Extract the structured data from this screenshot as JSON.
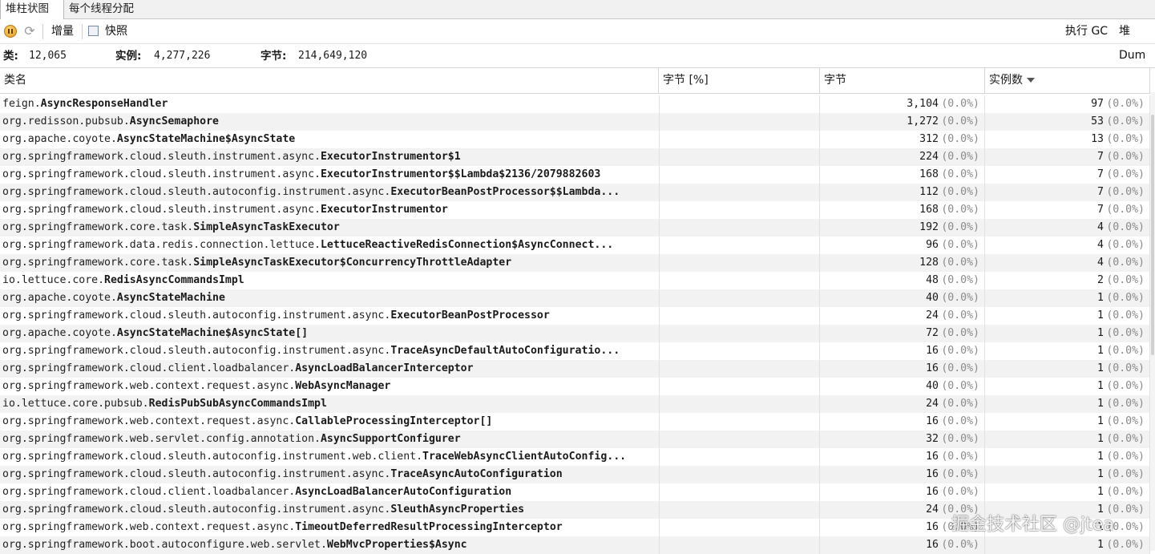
{
  "tabs": [
    {
      "label": "堆柱状图"
    },
    {
      "label": "每个线程分配"
    }
  ],
  "toolbar": {
    "delta_label": "增量",
    "snapshot_label": "快照",
    "gc_label": "执行 GC",
    "dump_label": "堆 Dum"
  },
  "stats": {
    "classes_label": "类:",
    "classes_value": "12,065",
    "instances_label": "实例:",
    "instances_value": "4,277,226",
    "bytes_label": "字节:",
    "bytes_value": "214,649,120"
  },
  "columns": {
    "class_name": "类名",
    "bytes_pct": "字节 [%]",
    "bytes": "字节",
    "instances": "实例数"
  },
  "rows": [
    {
      "pkg": "feign.",
      "cls": "AsyncResponseHandler",
      "bytes": "3,104",
      "bytes_pct": "(0.0%)",
      "inst": "97",
      "inst_pct": "(0.0%)"
    },
    {
      "pkg": "org.redisson.pubsub.",
      "cls": "AsyncSemaphore",
      "bytes": "1,272",
      "bytes_pct": "(0.0%)",
      "inst": "53",
      "inst_pct": "(0.0%)"
    },
    {
      "pkg": "org.apache.coyote.",
      "cls": "AsyncStateMachine$AsyncState",
      "bytes": "312",
      "bytes_pct": "(0.0%)",
      "inst": "13",
      "inst_pct": "(0.0%)"
    },
    {
      "pkg": "org.springframework.cloud.sleuth.instrument.async.",
      "cls": "ExecutorInstrumentor$1",
      "bytes": "224",
      "bytes_pct": "(0.0%)",
      "inst": "7",
      "inst_pct": "(0.0%)"
    },
    {
      "pkg": "org.springframework.cloud.sleuth.instrument.async.",
      "cls": "ExecutorInstrumentor$$Lambda$2136/2079882603",
      "bytes": "168",
      "bytes_pct": "(0.0%)",
      "inst": "7",
      "inst_pct": "(0.0%)"
    },
    {
      "pkg": "org.springframework.cloud.sleuth.autoconfig.instrument.async.",
      "cls": "ExecutorBeanPostProcessor$$Lambda...",
      "bytes": "112",
      "bytes_pct": "(0.0%)",
      "inst": "7",
      "inst_pct": "(0.0%)"
    },
    {
      "pkg": "org.springframework.cloud.sleuth.instrument.async.",
      "cls": "ExecutorInstrumentor",
      "bytes": "168",
      "bytes_pct": "(0.0%)",
      "inst": "7",
      "inst_pct": "(0.0%)"
    },
    {
      "pkg": "org.springframework.core.task.",
      "cls": "SimpleAsyncTaskExecutor",
      "bytes": "192",
      "bytes_pct": "(0.0%)",
      "inst": "4",
      "inst_pct": "(0.0%)"
    },
    {
      "pkg": "org.springframework.data.redis.connection.lettuce.",
      "cls": "LettuceReactiveRedisConnection$AsyncConnect...",
      "bytes": "96",
      "bytes_pct": "(0.0%)",
      "inst": "4",
      "inst_pct": "(0.0%)"
    },
    {
      "pkg": "org.springframework.core.task.",
      "cls": "SimpleAsyncTaskExecutor$ConcurrencyThrottleAdapter",
      "bytes": "128",
      "bytes_pct": "(0.0%)",
      "inst": "4",
      "inst_pct": "(0.0%)"
    },
    {
      "pkg": "io.lettuce.core.",
      "cls": "RedisAsyncCommandsImpl",
      "bytes": "48",
      "bytes_pct": "(0.0%)",
      "inst": "2",
      "inst_pct": "(0.0%)"
    },
    {
      "pkg": "org.apache.coyote.",
      "cls": "AsyncStateMachine",
      "bytes": "40",
      "bytes_pct": "(0.0%)",
      "inst": "1",
      "inst_pct": "(0.0%)"
    },
    {
      "pkg": "org.springframework.cloud.sleuth.autoconfig.instrument.async.",
      "cls": "ExecutorBeanPostProcessor",
      "bytes": "24",
      "bytes_pct": "(0.0%)",
      "inst": "1",
      "inst_pct": "(0.0%)"
    },
    {
      "pkg": "org.apache.coyote.",
      "cls": "AsyncStateMachine$AsyncState[]",
      "bytes": "72",
      "bytes_pct": "(0.0%)",
      "inst": "1",
      "inst_pct": "(0.0%)"
    },
    {
      "pkg": "org.springframework.cloud.sleuth.autoconfig.instrument.async.",
      "cls": "TraceAsyncDefaultAutoConfiguratio...",
      "bytes": "16",
      "bytes_pct": "(0.0%)",
      "inst": "1",
      "inst_pct": "(0.0%)"
    },
    {
      "pkg": "org.springframework.cloud.client.loadbalancer.",
      "cls": "AsyncLoadBalancerInterceptor",
      "bytes": "16",
      "bytes_pct": "(0.0%)",
      "inst": "1",
      "inst_pct": "(0.0%)"
    },
    {
      "pkg": "org.springframework.web.context.request.async.",
      "cls": "WebAsyncManager",
      "bytes": "40",
      "bytes_pct": "(0.0%)",
      "inst": "1",
      "inst_pct": "(0.0%)"
    },
    {
      "pkg": "io.lettuce.core.pubsub.",
      "cls": "RedisPubSubAsyncCommandsImpl",
      "bytes": "24",
      "bytes_pct": "(0.0%)",
      "inst": "1",
      "inst_pct": "(0.0%)"
    },
    {
      "pkg": "org.springframework.web.context.request.async.",
      "cls": "CallableProcessingInterceptor[]",
      "bytes": "16",
      "bytes_pct": "(0.0%)",
      "inst": "1",
      "inst_pct": "(0.0%)"
    },
    {
      "pkg": "org.springframework.web.servlet.config.annotation.",
      "cls": "AsyncSupportConfigurer",
      "bytes": "32",
      "bytes_pct": "(0.0%)",
      "inst": "1",
      "inst_pct": "(0.0%)"
    },
    {
      "pkg": "org.springframework.cloud.sleuth.autoconfig.instrument.web.client.",
      "cls": "TraceWebAsyncClientAutoConfig...",
      "bytes": "16",
      "bytes_pct": "(0.0%)",
      "inst": "1",
      "inst_pct": "(0.0%)"
    },
    {
      "pkg": "org.springframework.cloud.sleuth.autoconfig.instrument.async.",
      "cls": "TraceAsyncAutoConfiguration",
      "bytes": "16",
      "bytes_pct": "(0.0%)",
      "inst": "1",
      "inst_pct": "(0.0%)"
    },
    {
      "pkg": "org.springframework.cloud.client.loadbalancer.",
      "cls": "AsyncLoadBalancerAutoConfiguration",
      "bytes": "16",
      "bytes_pct": "(0.0%)",
      "inst": "1",
      "inst_pct": "(0.0%)"
    },
    {
      "pkg": "org.springframework.cloud.sleuth.autoconfig.instrument.async.",
      "cls": "SleuthAsyncProperties",
      "bytes": "24",
      "bytes_pct": "(0.0%)",
      "inst": "1",
      "inst_pct": "(0.0%)"
    },
    {
      "pkg": "org.springframework.web.context.request.async.",
      "cls": "TimeoutDeferredResultProcessingInterceptor",
      "bytes": "16",
      "bytes_pct": "(0.0%)",
      "inst": "1",
      "inst_pct": "(0.0%)"
    },
    {
      "pkg": "org.springframework.boot.autoconfigure.web.servlet.",
      "cls": "WebMvcProperties$Async",
      "bytes": "16",
      "bytes_pct": "(0.0%)",
      "inst": "1",
      "inst_pct": "(0.0%)"
    }
  ],
  "watermark": "掘金技术社区 @jtea"
}
